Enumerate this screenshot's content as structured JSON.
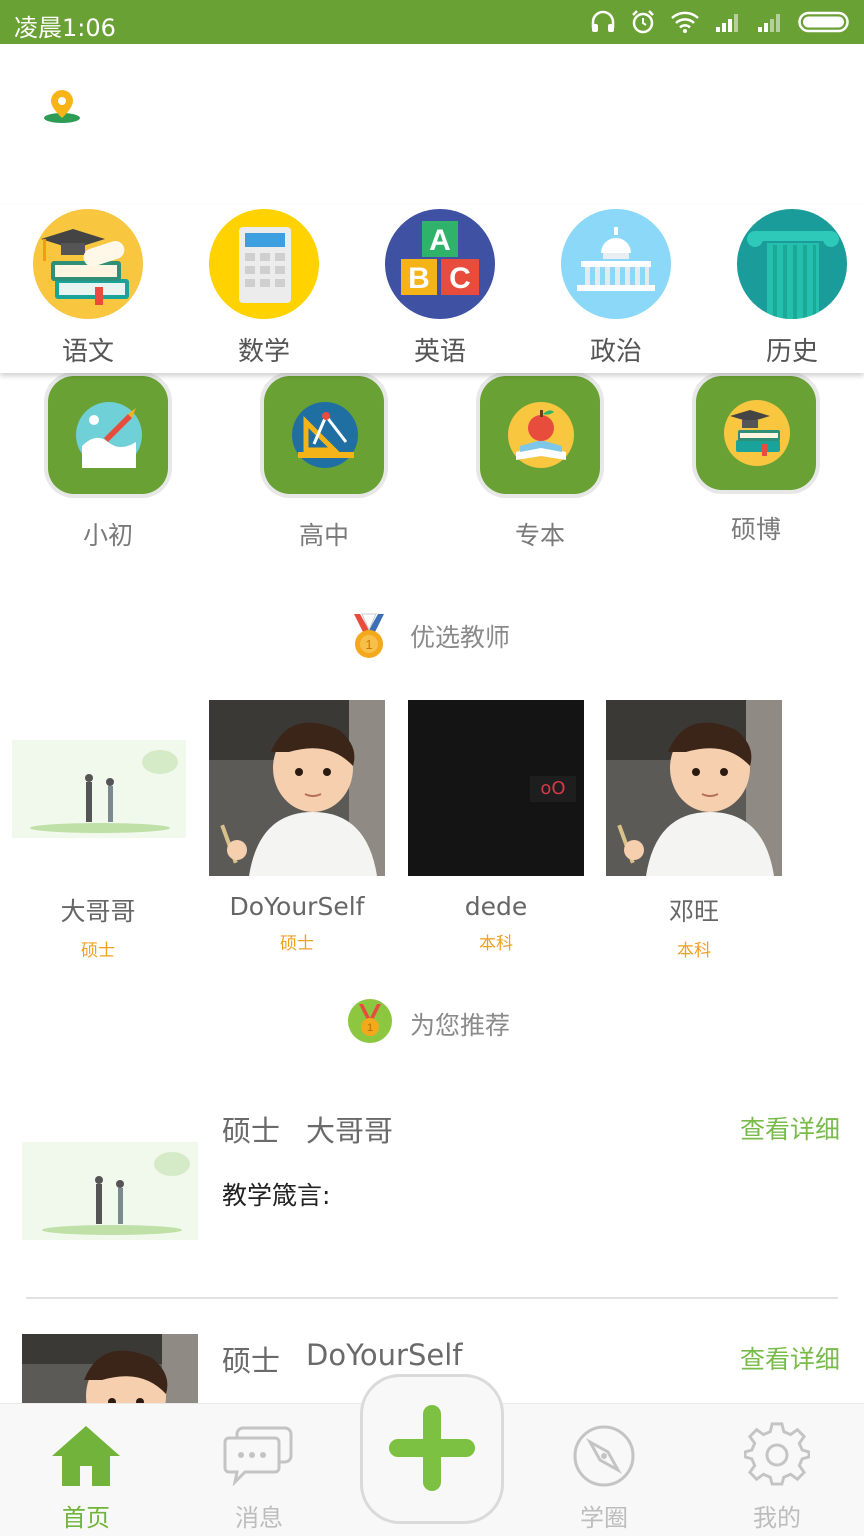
{
  "status_bar": {
    "time": "凌晨1:06"
  },
  "subjects": [
    {
      "label": "语文",
      "icon": "graduation-books-icon",
      "color": "#f9c640"
    },
    {
      "label": "数学",
      "icon": "calculator-icon",
      "color": "#ffd200"
    },
    {
      "label": "英语",
      "icon": "abc-blocks-icon",
      "color": "#3f51a3"
    },
    {
      "label": "政治",
      "icon": "capitol-building-icon",
      "color": "#8bd8f8"
    },
    {
      "label": "历史",
      "icon": "greek-column-icon",
      "color": "#1a9c9a"
    }
  ],
  "levels": [
    {
      "label": "小初",
      "icon": "rocket-globe-icon"
    },
    {
      "label": "高中",
      "icon": "geometry-tools-icon"
    },
    {
      "label": "专本",
      "icon": "apple-book-icon"
    },
    {
      "label": "硕博",
      "icon": "graduation-cap-books-icon"
    }
  ],
  "featured_teachers": {
    "title": "优选教师",
    "items": [
      {
        "name": "大哥哥",
        "degree": "硕士",
        "photo": "landscape-couple-photo"
      },
      {
        "name": "DoYourSelf",
        "degree": "硕士",
        "photo": "child-photo"
      },
      {
        "name": "dede",
        "degree": "本科",
        "photo": "dark-photo",
        "photo_text": "oO"
      },
      {
        "name": "邓旺",
        "degree": "本科",
        "photo": "child-photo"
      }
    ]
  },
  "recommend": {
    "title": "为您推荐",
    "items": [
      {
        "degree": "硕士",
        "name": "大哥哥",
        "detail": "查看详细",
        "motto_label": "教学箴言:"
      },
      {
        "degree": "硕士",
        "name": "DoYourSelf",
        "detail": "查看详细"
      }
    ]
  },
  "tabbar": {
    "tabs": [
      {
        "label": "首页",
        "icon": "home-icon",
        "active": true
      },
      {
        "label": "消息",
        "icon": "chat-bubble-icon",
        "active": false
      },
      {
        "label": "学圈",
        "icon": "compass-icon",
        "active": false
      },
      {
        "label": "我的",
        "icon": "gear-icon",
        "active": false
      }
    ],
    "add_icon": "plus-icon"
  },
  "colors": {
    "brand": "#6aa135",
    "accent_text": "#79bb4a",
    "degree_text": "#f0a020",
    "active_tab": "#72b43b"
  }
}
